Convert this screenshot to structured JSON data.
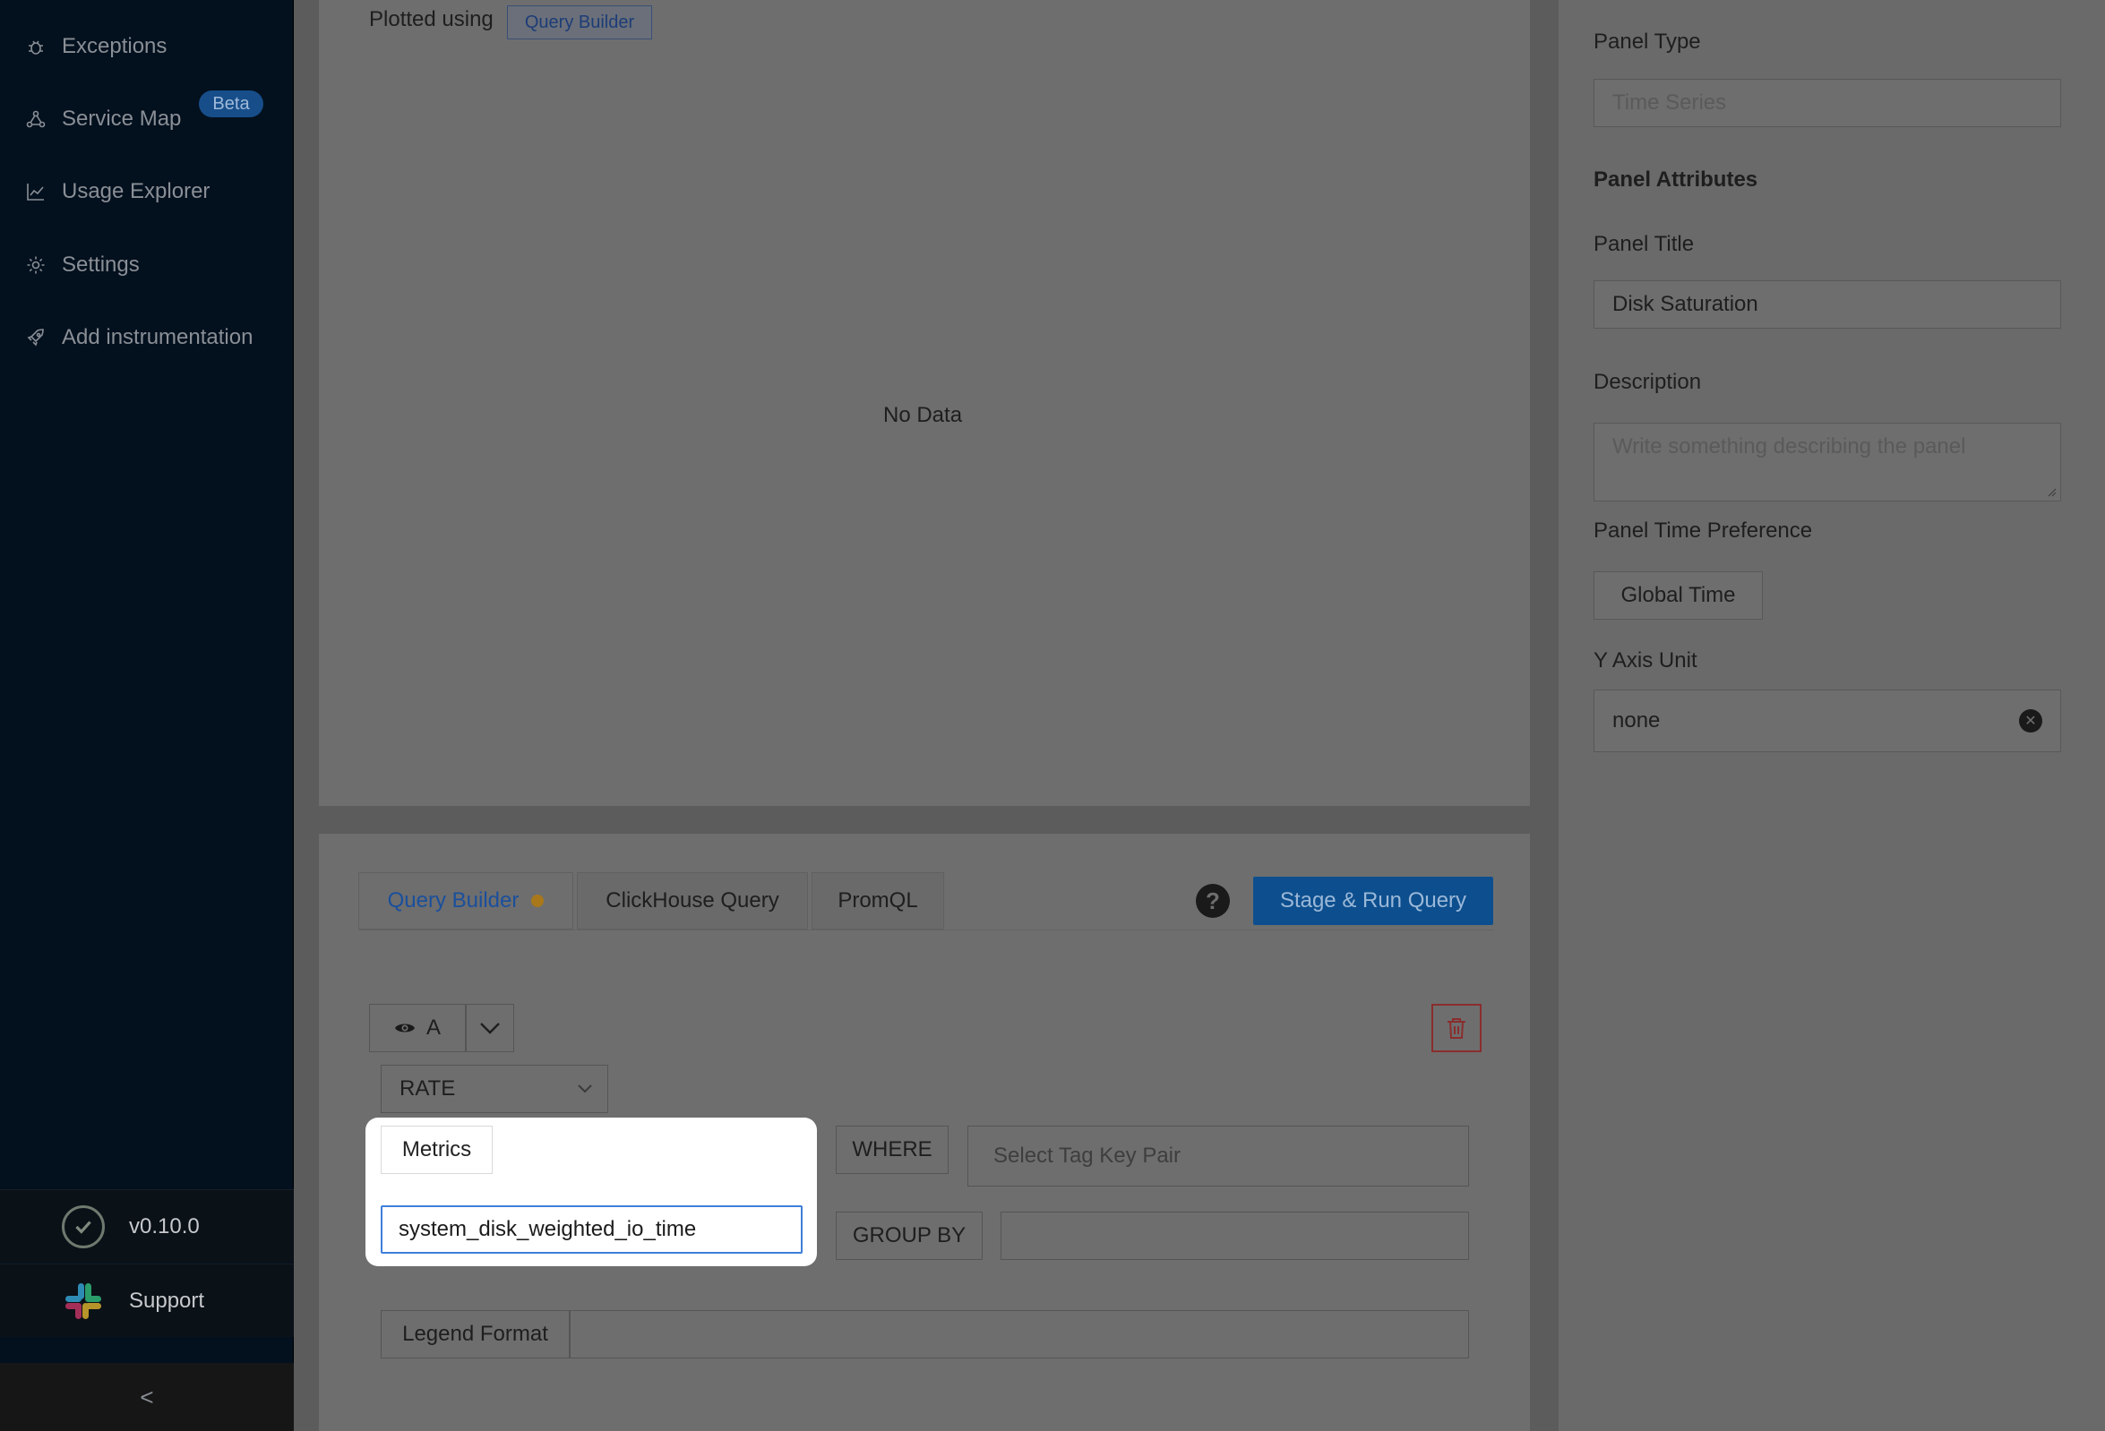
{
  "sidebar": {
    "items": [
      {
        "label": "Exceptions",
        "icon": "bug-icon"
      },
      {
        "label": "Service Map",
        "icon": "service-map-icon",
        "badge": "Beta"
      },
      {
        "label": "Usage Explorer",
        "icon": "line-chart-icon"
      },
      {
        "label": "Settings",
        "icon": "gear-icon"
      },
      {
        "label": "Add instrumentation",
        "icon": "rocket-icon"
      }
    ],
    "version": "v0.10.0",
    "support": "Support",
    "collapse": "<"
  },
  "chart": {
    "plotted_using": "Plotted using",
    "plotted_badge": "Query Builder",
    "empty_message": "No Data"
  },
  "query": {
    "tabs": [
      {
        "label": "Query Builder",
        "active": true
      },
      {
        "label": "ClickHouse Query"
      },
      {
        "label": "PromQL"
      }
    ],
    "help": "?",
    "run_button": "Stage & Run Query",
    "query_name": "A",
    "aggregation": "RATE",
    "metrics_label": "Metrics",
    "metric_value": "system_disk_weighted_io_time",
    "where_label": "WHERE",
    "tag_placeholder": "Select Tag Key Pair",
    "group_by_label": "GROUP BY",
    "legend_label": "Legend Format"
  },
  "panel": {
    "type_label": "Panel Type",
    "type_value": "Time Series",
    "attributes_heading": "Panel Attributes",
    "title_label": "Panel Title",
    "title_value": "Disk Saturation",
    "description_label": "Description",
    "description_placeholder": "Write something describing the  panel",
    "time_pref_label": "Panel Time Preference",
    "time_pref_value": "Global Time",
    "y_unit_label": "Y Axis Unit",
    "y_unit_value": "none"
  },
  "colors": {
    "sidebar_bg": "#03101e",
    "accent_blue": "#0d4f8e",
    "highlight": "#ffffff",
    "delete_red": "#8a2d2d"
  }
}
